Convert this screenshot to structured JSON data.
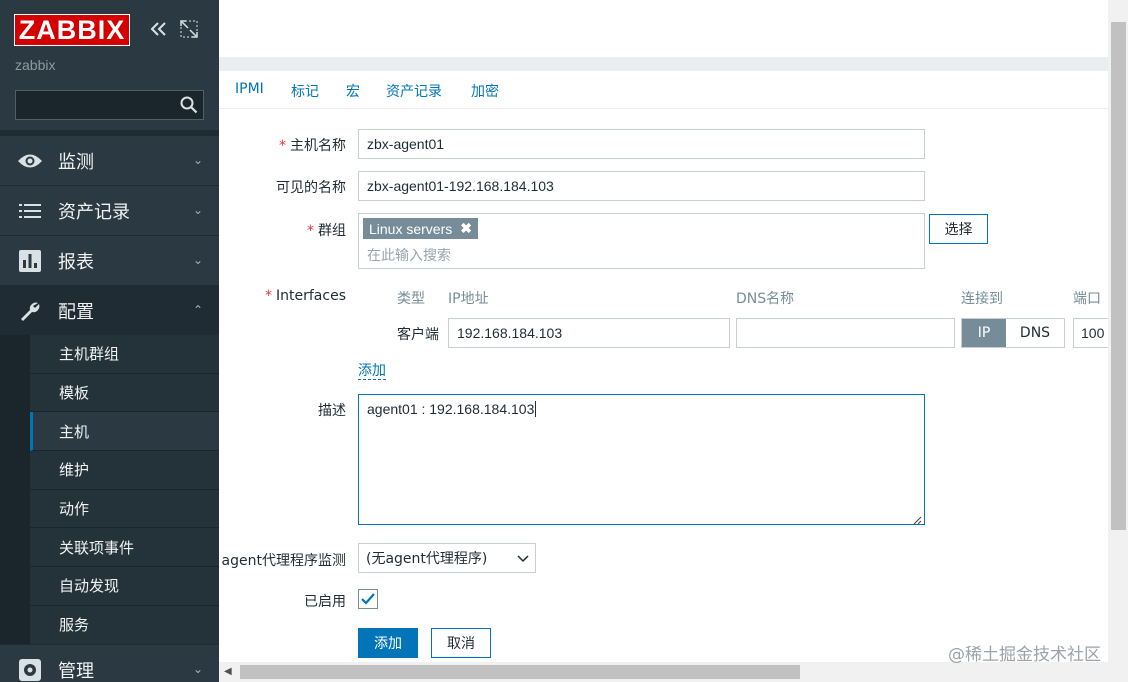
{
  "sidebar": {
    "logo": "ZABBIX",
    "server": "zabbix",
    "search_placeholder": "",
    "menu": [
      {
        "label": "监测",
        "icon": "eye-icon"
      },
      {
        "label": "资产记录",
        "icon": "list-icon"
      },
      {
        "label": "报表",
        "icon": "chart-icon"
      },
      {
        "label": "配置",
        "icon": "wrench-icon"
      },
      {
        "label": "管理",
        "icon": "gear-icon"
      }
    ],
    "submenu": [
      "主机群组",
      "模板",
      "主机",
      "维护",
      "动作",
      "关联项事件",
      "自动发现",
      "服务"
    ]
  },
  "tabs": [
    "IPMI",
    "标记",
    "宏",
    "资产记录",
    "加密"
  ],
  "form": {
    "hostname_label": "主机名称",
    "hostname_value": "zbx-agent01",
    "visible_label": "可见的名称",
    "visible_value": "zbx-agent01-192.168.184.103",
    "groups_label": "群组",
    "group_tag": "Linux servers",
    "group_placeholder": "在此输入搜索",
    "select_btn": "选择",
    "interfaces_label": "Interfaces",
    "iface_headers": {
      "type": "类型",
      "ip": "IP地址",
      "dns": "DNS名称",
      "connect": "连接到",
      "port": "端口"
    },
    "iface_type": "客户端",
    "iface_ip": "192.168.184.103",
    "iface_dns": "",
    "iface_connect": [
      "IP",
      "DNS"
    ],
    "iface_port": "100",
    "add_link": "添加",
    "desc_label": "描述",
    "desc_value": "agent01 : 192.168.184.103",
    "proxy_label": "agent代理程序监测",
    "proxy_value": "(无agent代理程序)",
    "enabled_label": "已启用",
    "enabled": true,
    "add_btn": "添加",
    "cancel_btn": "取消"
  },
  "watermark": "@稀土掘金技术社区",
  "colors": {
    "accent": "#0275b8",
    "sidebar": "#2b3a42",
    "logo": "#d40000",
    "required": "#e33734"
  }
}
